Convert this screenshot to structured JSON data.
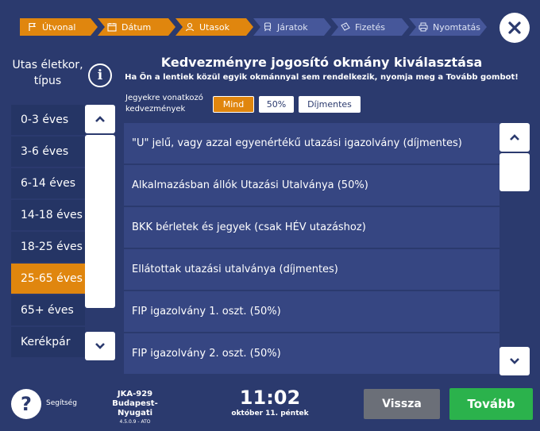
{
  "steps": [
    {
      "label": "Útvonal",
      "icon": "flag-icon",
      "state": "done"
    },
    {
      "label": "Dátum",
      "icon": "calendar-icon",
      "state": "done"
    },
    {
      "label": "Utasok",
      "icon": "user-icon",
      "state": "done"
    },
    {
      "label": "Járatok",
      "icon": "train-icon",
      "state": "todo"
    },
    {
      "label": "Fizetés",
      "icon": "ticket-icon",
      "state": "todo"
    },
    {
      "label": "Nyomtatás",
      "icon": "printer-icon",
      "state": "todo"
    }
  ],
  "left": {
    "title": "Utas életkor, típus",
    "info_symbol": "i",
    "ages": [
      "0-3 éves",
      "3-6 éves",
      "6-14 éves",
      "14-18 éves",
      "18-25 éves",
      "25-65 éves",
      "65+ éves",
      "Kerékpár"
    ],
    "selected_index": 5
  },
  "main": {
    "title": "Kedvezményre jogosító okmány kiválasztása",
    "subtitle": "Ha Ön a lentiek közül egyik okmánnyal sem rendelkezik, nyomja meg a Tovább gombot!",
    "filter_label": "Jegyekre vonatkozó kedvezmények",
    "filters": [
      "Mind",
      "50%",
      "Díjmentes"
    ],
    "active_filter": 0,
    "documents": [
      "\"U\" jelű, vagy azzal egyenértékű utazási igazolvány (díjmentes)",
      "Alkalmazásban állók Utazási Utalványa (50%)",
      "BKK bérletek és jegyek (csak HÉV utazáshoz)",
      "Ellátottak utazási utalványa (díjmentes)",
      "FIP igazolvány 1. oszt. (50%)",
      "FIP igazolvány 2. oszt. (50%)"
    ]
  },
  "footer": {
    "help_symbol": "?",
    "help_label": "Segítség",
    "station_code": "JKA-929",
    "station_name": "Budapest-Nyugati",
    "version": "4.5.0.9 - ATO",
    "time": "11:02",
    "date": "október 11. péntek",
    "back_label": "Vissza",
    "next_label": "Tovább"
  },
  "colors": {
    "background": "#2b3a6e",
    "accent": "#e0860e",
    "next": "#2bb24c",
    "back": "#6b6f78"
  }
}
